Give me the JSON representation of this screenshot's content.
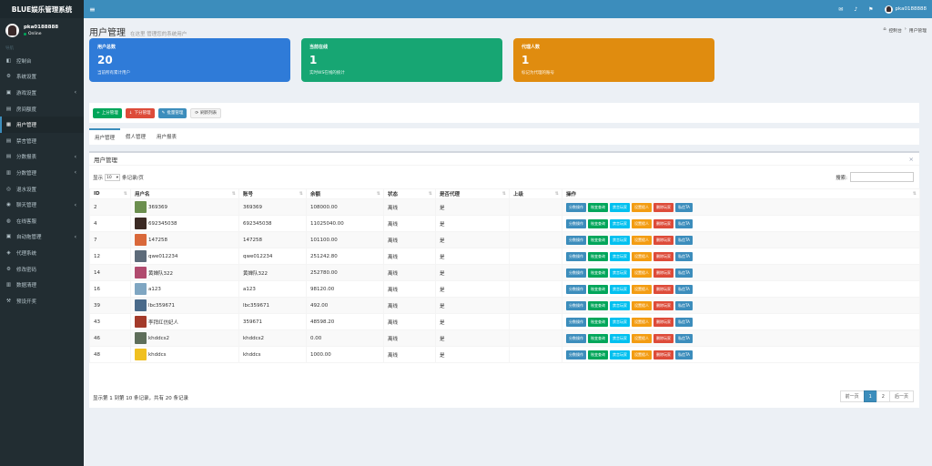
{
  "sidebar": {
    "app_title": "BLUE娱乐管理系统",
    "user": {
      "name": "pka0188888",
      "status": "Online"
    },
    "nav_header": "导航",
    "items": [
      {
        "label": "控制台",
        "icon": "dashboard-icon",
        "glyph": "◧",
        "chevron": ""
      },
      {
        "label": "系统设置",
        "icon": "gears-icon",
        "glyph": "⚙",
        "chevron": ""
      },
      {
        "label": "游戏设置",
        "icon": "gamepad-icon",
        "glyph": "▣",
        "chevron": "‹"
      },
      {
        "label": "房间额度",
        "icon": "book-icon",
        "glyph": "▤",
        "chevron": ""
      },
      {
        "label": "用户管理",
        "icon": "users-icon",
        "glyph": "▦",
        "chevron": ""
      },
      {
        "label": "禁言管理",
        "icon": "ban-icon",
        "glyph": "▤",
        "chevron": ""
      },
      {
        "label": "分数报表",
        "icon": "list-icon",
        "glyph": "▤",
        "chevron": "‹"
      },
      {
        "label": "分数管理",
        "icon": "table-icon",
        "glyph": "▥",
        "chevron": "‹"
      },
      {
        "label": "退水设置",
        "icon": "refresh-icon",
        "glyph": "◎",
        "chevron": ""
      },
      {
        "label": "聊天管理",
        "icon": "chat-icon",
        "glyph": "◉",
        "chevron": "‹"
      },
      {
        "label": "在线客服",
        "icon": "headset-icon",
        "glyph": "◍",
        "chevron": ""
      },
      {
        "label": "自动拖管理",
        "icon": "robot-icon",
        "glyph": "▣",
        "chevron": "‹"
      },
      {
        "label": "代理系统",
        "icon": "group-icon",
        "glyph": "◈",
        "chevron": ""
      },
      {
        "label": "修改密码",
        "icon": "gear-icon",
        "glyph": "⚙",
        "chevron": ""
      },
      {
        "label": "数据清理",
        "icon": "trash-icon",
        "glyph": "▥",
        "chevron": ""
      },
      {
        "label": "预设开奖",
        "icon": "cog-icon",
        "glyph": "⚒",
        "chevron": ""
      }
    ],
    "active_index": 4
  },
  "topbar": {
    "username": "pka0188888"
  },
  "header": {
    "title": "用户管理",
    "subtitle": "在这里 管理您的系统用户",
    "breadcrumb": {
      "home": "控制台",
      "sep": "›",
      "current": "用户管理"
    }
  },
  "stats": [
    {
      "title": "用户总数",
      "value": "20",
      "desc": "当前所有累计用户",
      "color": "#2f7bd8"
    },
    {
      "title": "当前在线",
      "value": "1",
      "desc": "实时WS在线的统计",
      "color": "#17a673"
    },
    {
      "title": "代理人数",
      "value": "1",
      "desc": "标记为代理的账号",
      "color": "#e08c0f"
    }
  ],
  "toolbar": [
    {
      "label": "上分管理",
      "color": "#00a65a",
      "glyph": "+"
    },
    {
      "label": "下分管理",
      "color": "#dd4b39",
      "glyph": "↓"
    },
    {
      "label": "批量管理",
      "color": "#3c8dbc",
      "glyph": "✎"
    },
    {
      "label": "刷新列表",
      "color": "#f4f4f4",
      "glyph": "⟳"
    }
  ],
  "tabs": [
    "用户管理",
    "假人管理",
    "用户报表"
  ],
  "panel": {
    "title": "用户管理",
    "close": "×",
    "show_label": "显示",
    "per_page": "10",
    "per_page_suffix": "条记录/页",
    "search_label": "搜索:",
    "columns": [
      "ID",
      "用户名",
      "账号",
      "余额",
      "状态",
      "是否代理",
      "上级",
      "操作"
    ],
    "action_buttons": [
      {
        "label": "分数操作",
        "color": "#3c8dbc"
      },
      {
        "label": "账变查询",
        "color": "#00a65a"
      },
      {
        "label": "禁言玩家",
        "color": "#00c0ef"
      },
      {
        "label": "设置假人",
        "color": "#f39c12"
      },
      {
        "label": "删除玩家",
        "color": "#dd4b39"
      },
      {
        "label": "私信TA",
        "color": "#3c8dbc"
      }
    ],
    "rows": [
      {
        "id": "2",
        "username": "369369",
        "account": "369369",
        "balance": "108000.00",
        "status": "离线",
        "agent": "是",
        "parent": "",
        "avatar": "#6b8e4e"
      },
      {
        "id": "4",
        "username": "692345038",
        "account": "692345038",
        "balance": "11025040.00",
        "status": "离线",
        "agent": "是",
        "parent": "",
        "avatar": "#3b2a24"
      },
      {
        "id": "7",
        "username": "147258",
        "account": "147258",
        "balance": "101100.00",
        "status": "离线",
        "agent": "是",
        "parent": "",
        "avatar": "#d9683a"
      },
      {
        "id": "12",
        "username": "qwe012234",
        "account": "qwe012234",
        "balance": "251242.80",
        "status": "离线",
        "agent": "是",
        "parent": "",
        "avatar": "#5d6b7a"
      },
      {
        "id": "14",
        "username": "黄婵队322",
        "account": "黄婵队322",
        "balance": "252780.00",
        "status": "离线",
        "agent": "是",
        "parent": "",
        "avatar": "#b04a6e"
      },
      {
        "id": "16",
        "username": "a123",
        "account": "a123",
        "balance": "98120.00",
        "status": "离线",
        "agent": "是",
        "parent": "",
        "avatar": "#7fa6c2"
      },
      {
        "id": "39",
        "username": "lbc359671",
        "account": "lbc359671",
        "balance": "492.00",
        "status": "离线",
        "agent": "是",
        "parent": "",
        "avatar": "#4a6a8a"
      },
      {
        "id": "43",
        "username": "李拜红仿妃人",
        "account": "359671",
        "balance": "48598.20",
        "status": "离线",
        "agent": "是",
        "parent": "",
        "avatar": "#a33a2a"
      },
      {
        "id": "46",
        "username": "khddcs2",
        "account": "khddcs2",
        "balance": "0.00",
        "status": "离线",
        "agent": "是",
        "parent": "",
        "avatar": "#5e6e5a"
      },
      {
        "id": "48",
        "username": "khddcs",
        "account": "khddcs",
        "balance": "1000.00",
        "status": "离线",
        "agent": "是",
        "parent": "",
        "avatar": "#f0c020"
      }
    ],
    "footer": "显示第 1 到第 10 条记录，共有 20 条记录",
    "pager": {
      "prev": "前一页",
      "pages": [
        "1",
        "2"
      ],
      "current": "1",
      "next": "后一页"
    }
  }
}
